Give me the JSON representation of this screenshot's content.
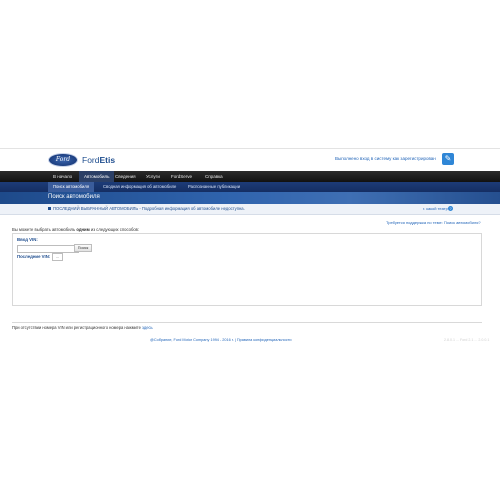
{
  "header": {
    "logo_text": "Ford",
    "brand_prefix": "Ford",
    "brand_suffix": "Etis",
    "greeting": "Выполнено вход в систему как зарегистрирован",
    "edit_icon": "pencil-icon"
  },
  "nav": {
    "items": [
      "В начало",
      "Автомобиль",
      "Сведения",
      "Услуги",
      "FordServe",
      "Справка"
    ],
    "active": "Автомобиль"
  },
  "subnav": {
    "items": [
      "Поиск автомобиля",
      "Сводная информация об автомобиле",
      "Распознанные публикации"
    ],
    "active": "Поиск автомобиля"
  },
  "page": {
    "title": "Поиск автомобиля",
    "info": "ПОСЛЕДНИЙ ВЫБРАННЫЙ АВТОМОБИЛЬ - Подробная информация об автомобиле недоступна.",
    "help_link": "г. какой театр?",
    "support_link": "Требуется поддержка по теме: Поиск автомобиля?"
  },
  "search": {
    "instruction_prefix": "Вы можете выбрать автомобиль ",
    "instruction_bold": "одним",
    "instruction_suffix": " из следующих способов:",
    "vin_label": "Ввод VIN:",
    "vin_value": "",
    "search_button": "Поиск",
    "last_vin_label": "Последние VIN:",
    "last_vin_value": "..."
  },
  "footer": {
    "note_prefix": "При отсутствии номера VIN или регистрационного номера нажмите ",
    "note_link": "здесь",
    "copyright": "@Собрание, Ford Motor Company 1994 - 2016 г. | Правила конфиденциальности",
    "version": "2.8.0.1 ... Ford 2.1 ... 2.0.0.1"
  }
}
